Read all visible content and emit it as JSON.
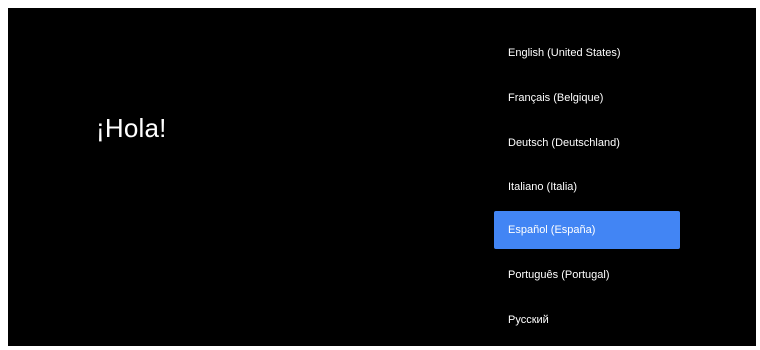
{
  "greeting": "¡Hola!",
  "languages": [
    {
      "label": "English (United States)"
    },
    {
      "label": "Français (Belgique)"
    },
    {
      "label": "Deutsch (Deutschland)"
    },
    {
      "label": "Italiano (Italia)"
    },
    {
      "label": "Español (España)",
      "selected": true
    },
    {
      "label": "Português (Portugal)"
    },
    {
      "label": "Русский"
    }
  ],
  "colors": {
    "background": "#000000",
    "text": "#ffffff",
    "selection": "#4285f4"
  }
}
